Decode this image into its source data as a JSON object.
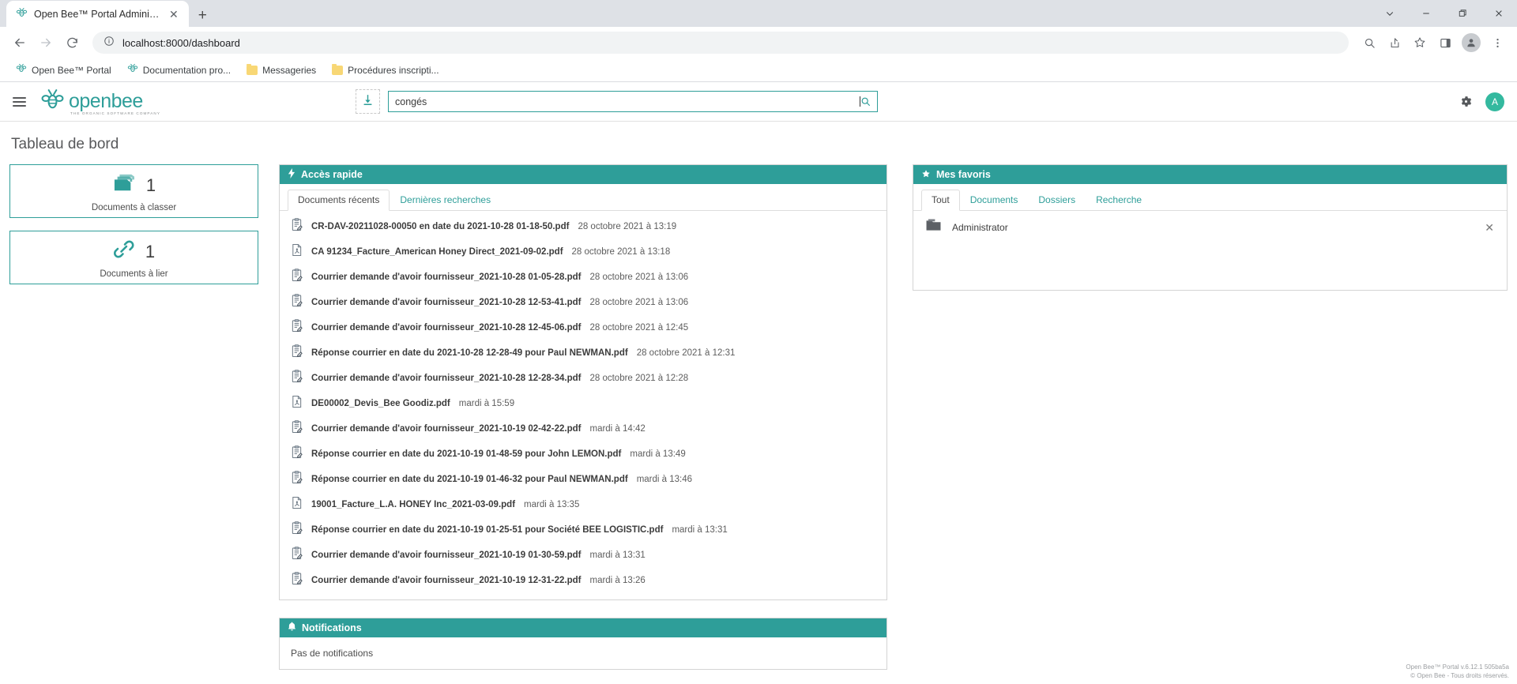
{
  "browser": {
    "tab_title": "Open Bee™ Portal Administrator",
    "tab_close_icon": "close-icon",
    "new_tab_icon": "plus-icon",
    "window_controls": [
      "chevron-down-icon",
      "minimize-icon",
      "maximize-icon",
      "close-icon"
    ],
    "nav": {
      "back": "back-arrow-icon",
      "forward": "forward-arrow-icon",
      "reload": "reload-icon"
    },
    "url": "localhost:8000/dashboard",
    "url_info_icon": "info-circle-icon",
    "toolbar_icons": [
      "zoom-out-icon",
      "share-icon",
      "bookmark-star-icon",
      "side-panel-icon",
      "profile-icon",
      "more-menu-icon"
    ],
    "bookmarks": [
      {
        "label": "Open Bee™ Portal",
        "icon": "bee-icon"
      },
      {
        "label": "Documentation pro...",
        "icon": "bee-icon"
      },
      {
        "label": "Messageries",
        "icon": "folder-icon"
      },
      {
        "label": "Procédures inscripti...",
        "icon": "folder-icon"
      }
    ]
  },
  "app_header": {
    "menu_icon": "hamburger-menu-icon",
    "logo_text": "openbee",
    "logo_tagline": "THE ORGANIC SOFTWARE COMPANY",
    "import_icon": "download-import-icon",
    "search_value": "congés",
    "search_placeholder": "",
    "search_icon": "search-icon",
    "settings_icon": "gear-icon",
    "avatar_initial": "A"
  },
  "page": {
    "title": "Tableau de bord",
    "stats": [
      {
        "icon": "stacked-documents-icon",
        "count": "1",
        "label": "Documents à classer"
      },
      {
        "icon": "chain-link-icon",
        "count": "1",
        "label": "Documents à lier"
      }
    ],
    "quick_access": {
      "icon": "lightning-bolt-icon",
      "title": "Accès rapide",
      "tabs": [
        {
          "label": "Documents récents",
          "active": true
        },
        {
          "label": "Dernières recherches",
          "active": false
        }
      ],
      "documents": [
        {
          "icon": "letter-doc-icon",
          "name": "CR-DAV-20211028-00050 en date du 2021-10-28 01-18-50.pdf",
          "date": "28 octobre 2021 à 13:19"
        },
        {
          "icon": "pdf-icon",
          "name": "CA 91234_Facture_American Honey Direct_2021-09-02.pdf",
          "date": "28 octobre 2021 à 13:18"
        },
        {
          "icon": "letter-doc-icon",
          "name": "Courrier demande d'avoir fournisseur_2021-10-28 01-05-28.pdf",
          "date": "28 octobre 2021 à 13:06"
        },
        {
          "icon": "letter-doc-icon",
          "name": "Courrier demande d'avoir fournisseur_2021-10-28 12-53-41.pdf",
          "date": "28 octobre 2021 à 13:06"
        },
        {
          "icon": "letter-doc-icon",
          "name": "Courrier demande d'avoir fournisseur_2021-10-28 12-45-06.pdf",
          "date": "28 octobre 2021 à 12:45"
        },
        {
          "icon": "letter-doc-icon",
          "name": "Réponse courrier en date du 2021-10-28 12-28-49 pour Paul NEWMAN.pdf",
          "date": "28 octobre 2021 à 12:31"
        },
        {
          "icon": "letter-doc-icon",
          "name": "Courrier demande d'avoir fournisseur_2021-10-28 12-28-34.pdf",
          "date": "28 octobre 2021 à 12:28"
        },
        {
          "icon": "pdf-icon",
          "name": "DE00002_Devis_Bee Goodiz.pdf",
          "date": "mardi à 15:59"
        },
        {
          "icon": "letter-doc-icon",
          "name": "Courrier demande d'avoir fournisseur_2021-10-19 02-42-22.pdf",
          "date": "mardi à 14:42"
        },
        {
          "icon": "letter-doc-icon",
          "name": "Réponse courrier en date du 2021-10-19 01-48-59 pour John LEMON.pdf",
          "date": "mardi à 13:49"
        },
        {
          "icon": "letter-doc-icon",
          "name": "Réponse courrier en date du 2021-10-19 01-46-32 pour Paul NEWMAN.pdf",
          "date": "mardi à 13:46"
        },
        {
          "icon": "pdf-icon",
          "name": "19001_Facture_L.A. HONEY Inc_2021-03-09.pdf",
          "date": "mardi à 13:35"
        },
        {
          "icon": "letter-doc-icon",
          "name": "Réponse courrier en date du 2021-10-19 01-25-51 pour Société BEE LOGISTIC.pdf",
          "date": "mardi à 13:31"
        },
        {
          "icon": "letter-doc-icon",
          "name": "Courrier demande d'avoir fournisseur_2021-10-19 01-30-59.pdf",
          "date": "mardi à 13:31"
        },
        {
          "icon": "letter-doc-icon",
          "name": "Courrier demande d'avoir fournisseur_2021-10-19 12-31-22.pdf",
          "date": "mardi à 13:26"
        }
      ]
    },
    "favorites": {
      "icon": "star-icon",
      "title": "Mes favoris",
      "tabs": [
        {
          "label": "Tout",
          "active": true
        },
        {
          "label": "Documents",
          "active": false
        },
        {
          "label": "Dossiers",
          "active": false
        },
        {
          "label": "Recherche",
          "active": false
        }
      ],
      "items": [
        {
          "icon": "folder-icon",
          "name": "Administrator",
          "remove_icon": "close-icon"
        }
      ]
    },
    "notifications": {
      "icon": "bell-icon",
      "title": "Notifications",
      "empty_text": "Pas de notifications"
    },
    "footer": {
      "line1": "Open Bee™ Portal v.6.12.1 505ba5a",
      "line2": "© Open Bee - Tous droits réservés."
    }
  },
  "colors": {
    "accent_teal": "#2e9e99",
    "avatar_green": "#34b99f",
    "folder_yellow": "#f8d775"
  }
}
